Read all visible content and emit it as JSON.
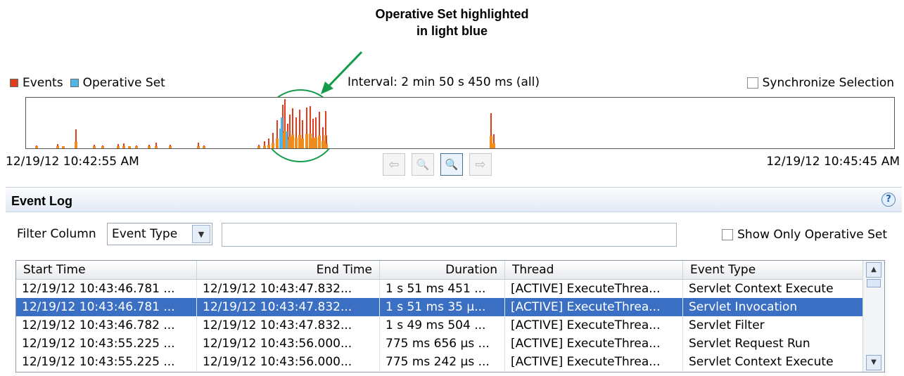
{
  "callout": {
    "text": "Operative Set highlighted\nin light blue",
    "color": "#149b4a"
  },
  "legend": {
    "events_label": "Events",
    "events_color": "#e03b1b",
    "operative_label": "Operative Set",
    "operative_color": "#4fb6e8"
  },
  "interval": "Interval: 2 min 50 s 450 ms (all)",
  "sync_label": "Synchronize Selection",
  "timeline": {
    "start": "12/19/12 10:42:55 AM",
    "end": "12/19/12 10:45:45 AM",
    "buttons": [
      {
        "name": "scroll-left-button",
        "icon": "arrow-left-icon",
        "glyph": "⇦",
        "enabled": false
      },
      {
        "name": "zoom-out-button",
        "icon": "zoom-out-icon",
        "glyph": "🔍",
        "enabled": false
      },
      {
        "name": "zoom-in-button",
        "icon": "zoom-in-icon",
        "glyph": "🔍",
        "enabled": true
      },
      {
        "name": "scroll-right-button",
        "icon": "arrow-right-icon",
        "glyph": "⇨",
        "enabled": false
      }
    ]
  },
  "event_log": {
    "title": "Event Log",
    "help_glyph": "?",
    "filter_label": "Filter Column",
    "filter_value": "Event Type",
    "filter_text": "",
    "show_operative_label": "Show Only Operative Set",
    "columns": [
      "Start Time",
      "End Time",
      "Duration",
      "Thread",
      "Event Type"
    ],
    "rows": [
      {
        "start": "12/19/12 10:43:46.781 ...",
        "end": "12/19/12 10:43:47.832...",
        "duration": "1 s 51 ms 451 ...",
        "thread": "[ACTIVE] ExecuteThrea...",
        "type": "Servlet Context Execute",
        "selected": false
      },
      {
        "start": "12/19/12 10:43:46.781 ...",
        "end": "12/19/12 10:43:47.832...",
        "duration": "1 s 51 ms 35 µ...",
        "thread": "[ACTIVE] ExecuteThrea...",
        "type": "Servlet Invocation",
        "selected": true
      },
      {
        "start": "12/19/12 10:43:46.782 ...",
        "end": "12/19/12 10:43:47.832...",
        "duration": "1 s 49 ms 504 ...",
        "thread": "[ACTIVE] ExecuteThrea...",
        "type": "Servlet Filter",
        "selected": false
      },
      {
        "start": "12/19/12 10:43:55.225 ...",
        "end": "12/19/12 10:43:56.000...",
        "duration": "775 ms 656 µs ...",
        "thread": "[ACTIVE] ExecuteThrea...",
        "type": "Servlet Request Run",
        "selected": false
      },
      {
        "start": "12/19/12 10:43:55.225 ...",
        "end": "12/19/12 10:43:56.000...",
        "duration": "775 ms 242 µs ...",
        "thread": "[ACTIVE] ExecuteThrea...",
        "type": "Servlet Context Execute",
        "selected": false
      }
    ]
  }
}
